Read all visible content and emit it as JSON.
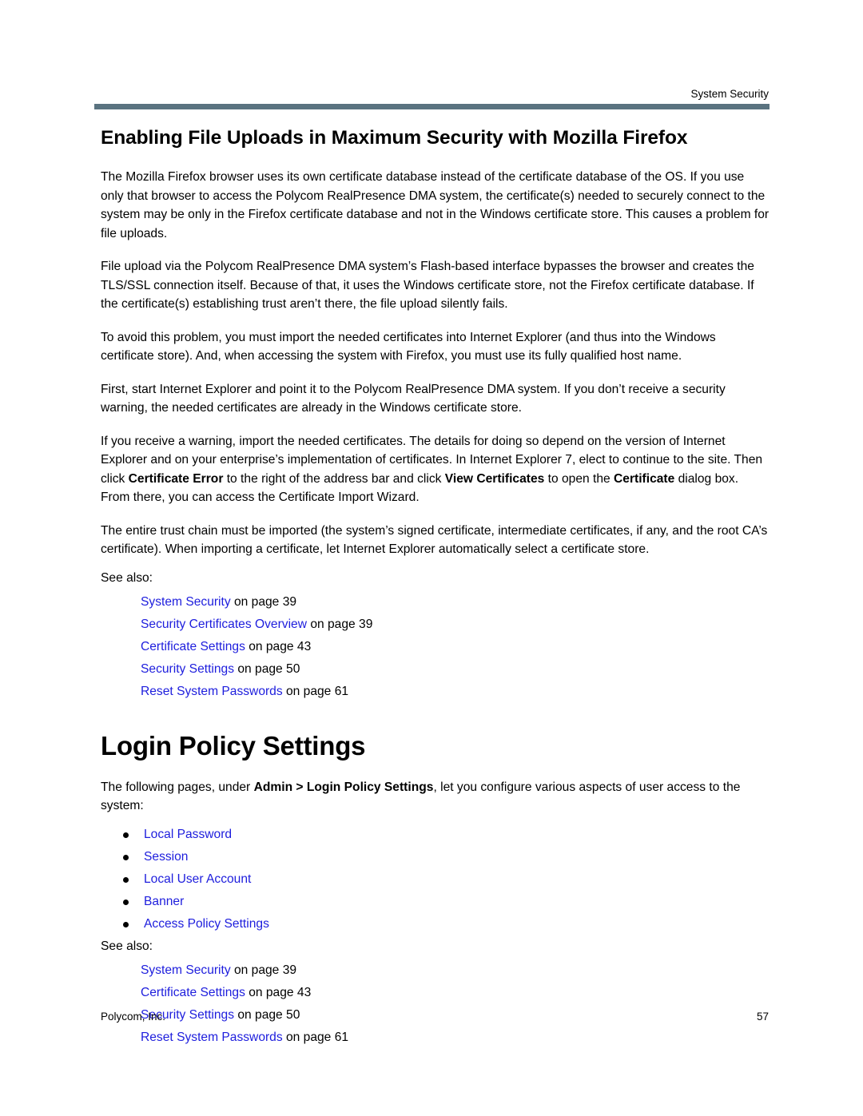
{
  "header": {
    "running_head": "System Security",
    "rule_color": "#5a7380"
  },
  "link_color": "#1d1ddd",
  "sections": {
    "firefox": {
      "title": "Enabling File Uploads in Maximum Security with Mozilla Firefox",
      "paragraphs": [
        "The Mozilla Firefox browser uses its own certificate database instead of the certificate database of the OS. If you use only that browser to access the Polycom RealPresence DMA system, the certificate(s) needed to securely connect to the system may be only in the Firefox certificate database and not in the Windows certificate store. This causes a problem for file uploads.",
        "File upload via the Polycom RealPresence DMA system’s Flash-based interface bypasses the browser and creates the TLS/SSL connection itself. Because of that, it uses the Windows certificate store, not the Firefox certificate database. If the certificate(s) establishing trust aren’t there, the file upload silently fails.",
        "To avoid this problem, you must import the needed certificates into Internet Explorer (and thus into the Windows certificate store). And, when accessing the system with Firefox, you must use its fully qualified host name.",
        "First, start Internet Explorer and point it to the Polycom RealPresence DMA system. If you don’t receive a security warning, the needed certificates are already in the Windows certificate store."
      ],
      "paragraph_ie": {
        "part1": "If you receive a warning, import the needed certificates. The details for doing so depend on the version of Internet Explorer and on your enterprise’s implementation of certificates. In Internet Explorer 7, elect to continue to the site. Then click ",
        "bold1": "Certificate Error",
        "part2": " to the right of the address bar and click ",
        "bold2": "View Certificates",
        "part3": " to open the ",
        "bold3": "Certificate",
        "part4": " dialog box. From there, you can access the Certificate Import Wizard."
      },
      "paragraph_trust": "The entire trust chain must be imported (the system’s signed certificate, intermediate certificates, if any, and the root CA’s certificate). When importing a certificate, let Internet Explorer automatically select a certificate store.",
      "see_also_label": "See also:",
      "see_also": [
        {
          "link": "System Security",
          "suffix": " on page 39"
        },
        {
          "link": "Security Certificates Overview",
          "suffix": " on page 39"
        },
        {
          "link": "Certificate Settings",
          "suffix": " on page 43"
        },
        {
          "link": "Security Settings",
          "suffix": " on page 50"
        },
        {
          "link": "Reset System Passwords",
          "suffix": " on page 61"
        }
      ]
    },
    "login_policy": {
      "title": "Login Policy Settings",
      "intro": {
        "part1": "The following pages, under ",
        "bold1": "Admin > Login Policy Settings",
        "part2": ", let you configure various aspects of user access to the system:"
      },
      "bullets": [
        "Local Password",
        "Session",
        "Local User Account",
        "Banner",
        "Access Policy Settings"
      ],
      "see_also_label": "See also:",
      "see_also": [
        {
          "link": "System Security",
          "suffix": " on page 39"
        },
        {
          "link": "Certificate Settings",
          "suffix": " on page 43"
        },
        {
          "link": "Security Settings",
          "suffix": " on page 50"
        },
        {
          "link": "Reset System Passwords",
          "suffix": " on page 61"
        }
      ]
    }
  },
  "footer": {
    "company": "Polycom, Inc.",
    "page_number": "57"
  }
}
